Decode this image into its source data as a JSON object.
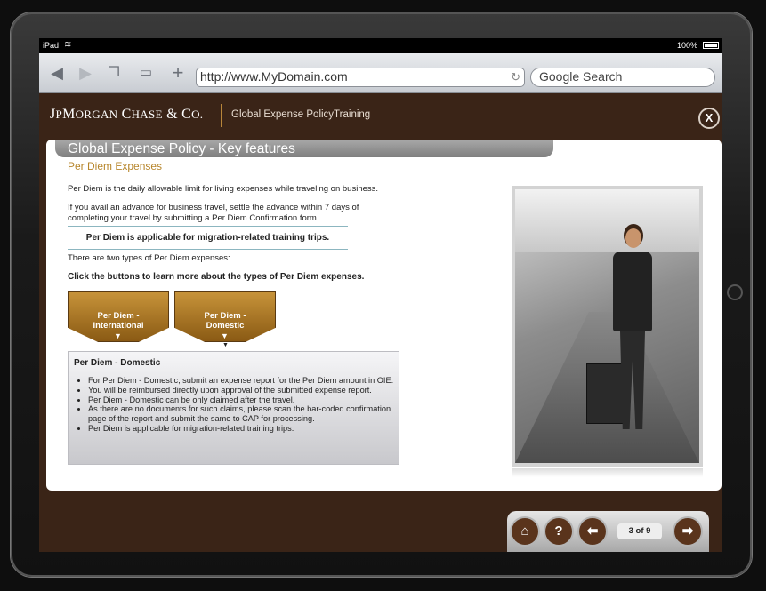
{
  "status_bar": {
    "device": "iPad",
    "battery": "100%"
  },
  "browser": {
    "url": "http://www.MyDomain.com",
    "search_placeholder": "Google Search"
  },
  "brand": {
    "logo": "JPMorgan Chase & Co.",
    "course_title": "Global Expense PolicyTraining",
    "close_label": "X"
  },
  "page": {
    "title": "Global Expense Policy - Key features",
    "section": "Per Diem Expenses",
    "para1": "Per Diem is the daily allowable limit for living expenses while traveling on business.",
    "para2": "If you avail an advance for business travel, settle the advance within 7 days of completing your travel by submitting a Per Diem Confirmation form.",
    "highlight": "Per Diem is applicable for migration-related training trips.",
    "para3": "There are two types of Per Diem expenses:",
    "instruction": "Click the buttons to learn more about the types of Per Diem expenses.",
    "buttons": [
      {
        "label_line1": "Per Diem -",
        "label_line2": "International"
      },
      {
        "label_line1": "Per Diem -",
        "label_line2": "Domestic"
      }
    ],
    "panel": {
      "title": "Per Diem - Domestic",
      "bullets": [
        "For Per Diem - Domestic, submit an expense report for the Per Diem amount in OIE.",
        "You will be reimbursed directly upon approval of the submitted expense report.",
        "Per Diem - Domestic can be only claimed after the travel.",
        "As there are no documents for such claims, please scan the bar-coded confirmation page of the report and submit the same to CAP for processing.",
        "Per Diem is applicable for migration-related training trips."
      ]
    }
  },
  "nav": {
    "page_counter": "3 of 9"
  },
  "colors": {
    "brand_brown": "#3a2417",
    "accent_gold": "#b7862c",
    "nav_button": "#5a341c"
  }
}
